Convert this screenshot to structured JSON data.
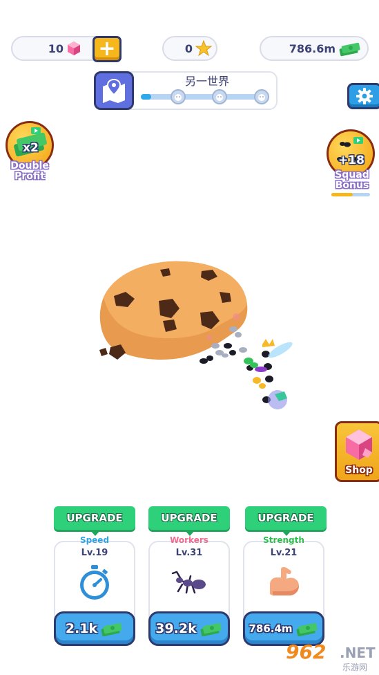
{
  "hud": {
    "gems": "10",
    "stars": "0",
    "cash": "786.6m"
  },
  "level_bar": {
    "world_name": "另一世界",
    "progress": 0.08,
    "stages": 3
  },
  "boosts": {
    "double_profit": {
      "badge": "x2",
      "label_line1": "Double",
      "label_line2": "Profit"
    },
    "squad_bonus": {
      "badge": "+18",
      "label_line1": "Squad",
      "label_line2": "Bonus",
      "progress": 0.55
    }
  },
  "shop": {
    "label": "Shop"
  },
  "upgrades": [
    {
      "tag": "UPGRADE",
      "name": "Speed",
      "name_color": "#2fa3e6",
      "level": "Lv.19",
      "icon": "stopwatch-icon",
      "price": "2.1k"
    },
    {
      "tag": "UPGRADE",
      "name": "Workers",
      "name_color": "#f06b8f",
      "level": "Lv.31",
      "icon": "ant-icon",
      "price": "39.2k"
    },
    {
      "tag": "UPGRADE",
      "name": "Strength",
      "name_color": "#2dbf4e",
      "level": "Lv.21",
      "icon": "bicep-icon",
      "price": "786.4m"
    }
  ],
  "watermark": {
    "number": "962",
    "suffix": ".NET",
    "cn": "乐游网"
  },
  "colors": {
    "accent_blue": "#45a9ee",
    "accent_yellow": "#f5b71c",
    "upgrade_green": "#2fd07a",
    "outline": "#2e3a6e"
  }
}
